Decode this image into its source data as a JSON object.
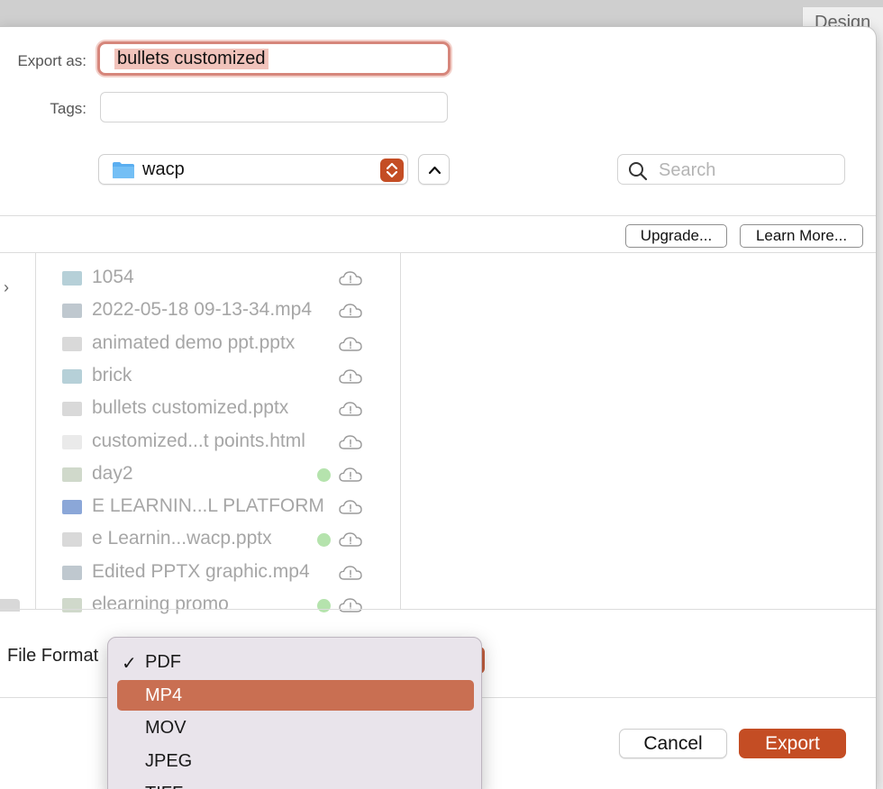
{
  "background": {
    "panel_title": "Design"
  },
  "dialog": {
    "export_as_label": "Export as:",
    "export_as_value": "bullets customized",
    "tags_label": "Tags:",
    "tags_value": "",
    "location": {
      "folder": "wacp",
      "folder_icon": "folder-icon"
    },
    "search_placeholder": "Search",
    "upgrade_label": "Upgrade...",
    "learn_more_label": "Learn More...",
    "files": [
      {
        "name": "1054",
        "icon": "image-thumb",
        "synced": false
      },
      {
        "name": "2022-05-18 09-13-34.mp4",
        "icon": "video-thumb",
        "synced": false
      },
      {
        "name": "animated demo ppt.pptx",
        "icon": "pptx-thumb",
        "synced": false
      },
      {
        "name": "brick",
        "icon": "image-thumb",
        "synced": false
      },
      {
        "name": "bullets customized.pptx",
        "icon": "pptx-thumb",
        "synced": false
      },
      {
        "name": "customized...t points.html",
        "icon": "html-doc",
        "synced": false
      },
      {
        "name": "day2",
        "icon": "doc-thumb",
        "synced": true
      },
      {
        "name": "E LEARNIN...L PLATFORM",
        "icon": "word-doc",
        "synced": false
      },
      {
        "name": "e Learnin...wacp.pptx",
        "icon": "pptx-thumb",
        "synced": true
      },
      {
        "name": "Edited PPTX graphic.mp4",
        "icon": "video-thumb",
        "synced": false
      },
      {
        "name": "elearning promo",
        "icon": "doc-thumb",
        "synced": true
      }
    ],
    "file_format_label": "File Format",
    "format_options": [
      {
        "label": "PDF",
        "checked": true,
        "highlighted": false
      },
      {
        "label": "MP4",
        "checked": false,
        "highlighted": true
      },
      {
        "label": "MOV",
        "checked": false,
        "highlighted": false
      },
      {
        "label": "JPEG",
        "checked": false,
        "highlighted": false
      },
      {
        "label": "TIFF",
        "checked": false,
        "highlighted": false
      }
    ],
    "checkmark": "✓",
    "cancel_label": "Cancel",
    "export_label": "Export"
  },
  "colors": {
    "accent": "#c44d24",
    "highlight": "#c96f52",
    "focus_ring": "#d6867b",
    "synced_dot": "#b5e3ad"
  }
}
